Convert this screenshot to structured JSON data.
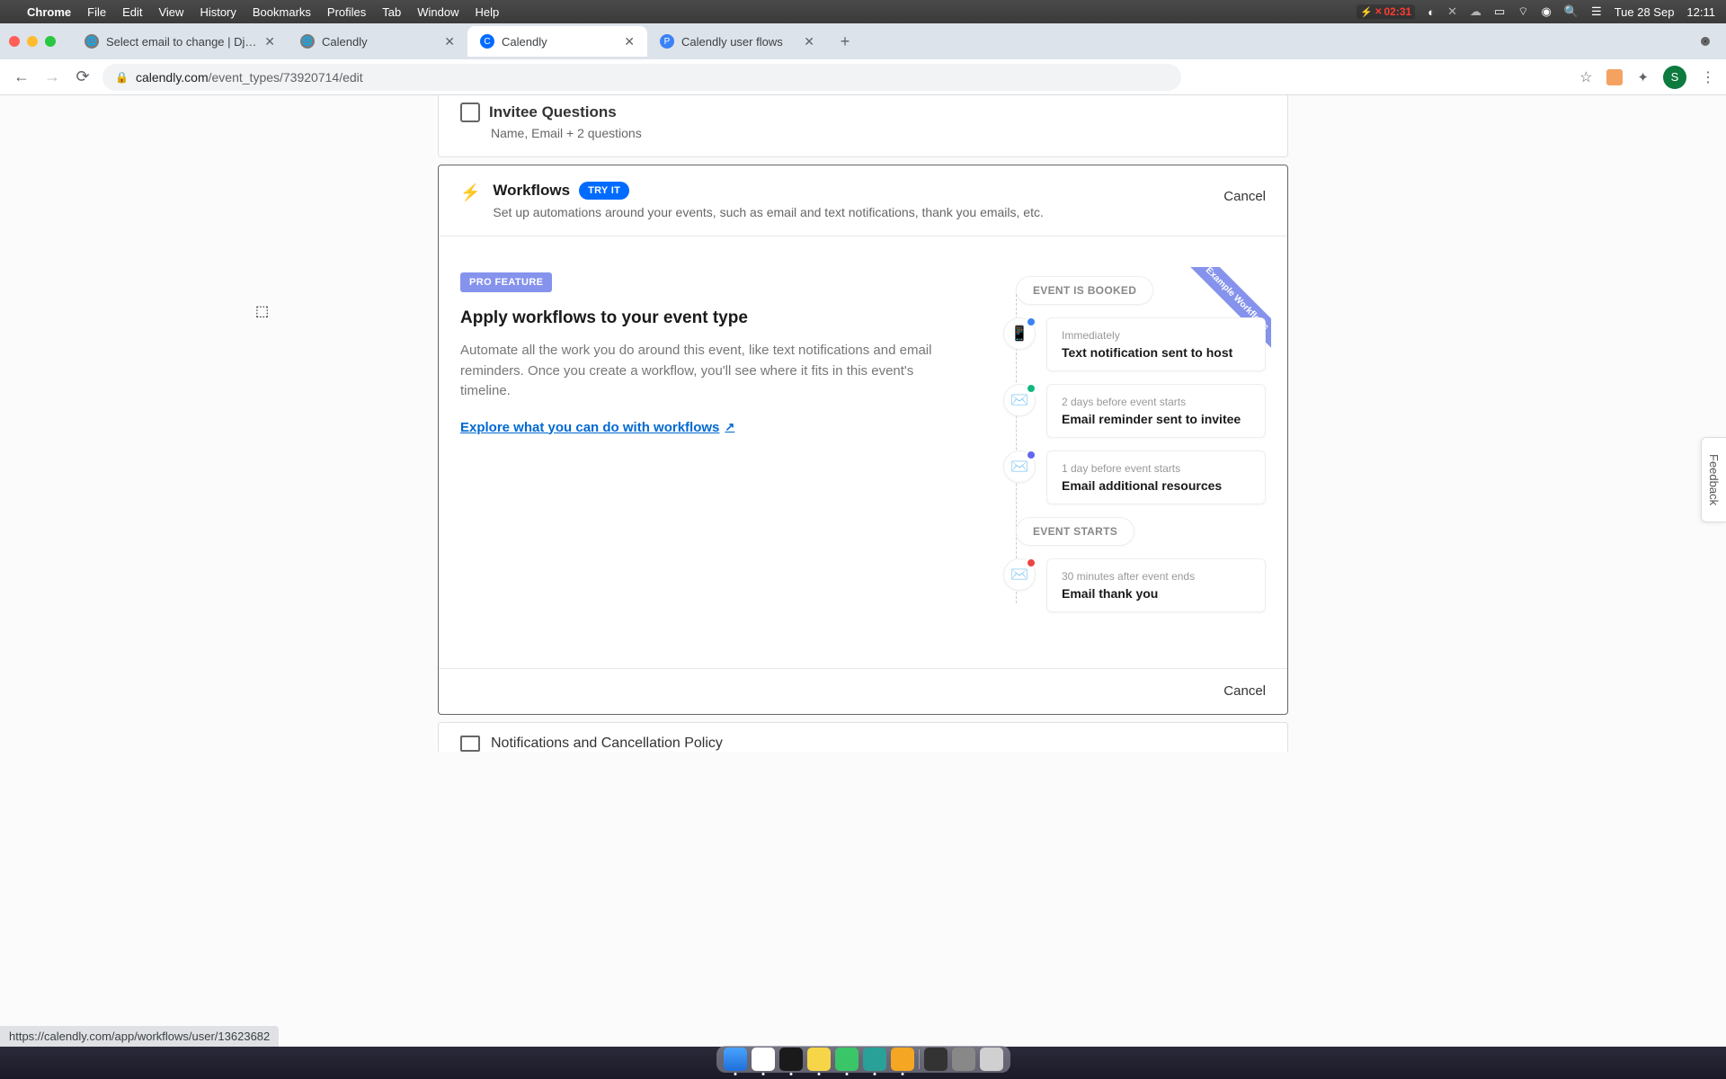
{
  "menubar": {
    "app": "Chrome",
    "menus": [
      "File",
      "Edit",
      "View",
      "History",
      "Bookmarks",
      "Profiles",
      "Tab",
      "Window",
      "Help"
    ],
    "battery_time": "02:31",
    "date": "Tue 28 Sep",
    "time": "12:11"
  },
  "tabs": [
    {
      "title": "Select email to change | Django",
      "favicon": "globe"
    },
    {
      "title": "Calendly",
      "favicon": "globe"
    },
    {
      "title": "Calendly",
      "favicon": "calendly",
      "active": true
    },
    {
      "title": "Calendly user flows",
      "favicon": "pf"
    }
  ],
  "omnibox": {
    "domain": "calendly.com",
    "path": "/event_types/73920714/edit"
  },
  "avatar_initial": "S",
  "sections": {
    "invitee": {
      "title": "Invitee Questions",
      "subtitle": "Name, Email + 2 questions"
    },
    "workflows": {
      "title": "Workflows",
      "try_label": "TRY IT",
      "subtitle": "Set up automations around your events, such as email and text notifications, thank you emails, etc.",
      "cancel": "Cancel",
      "pro_badge": "PRO FEATURE",
      "heading": "Apply workflows to your event type",
      "body": "Automate all the work you do around this event, like text notifications and email reminders. Once you create a workflow, you'll see where it fits in this event's timeline.",
      "link": "Explore what you can do with workflows",
      "ribbon": "Example Workflows",
      "timeline": {
        "pill1": "EVENT IS BOOKED",
        "pill2": "EVENT STARTS",
        "items": [
          {
            "when": "Immediately",
            "what": "Text notification sent to host",
            "icon": "phone",
            "badge": "blue"
          },
          {
            "when": "2 days before event starts",
            "what": "Email reminder sent to invitee",
            "icon": "mail",
            "badge": "green"
          },
          {
            "when": "1 day before event starts",
            "what": "Email additional resources",
            "icon": "mail",
            "badge": "indigo"
          },
          {
            "when": "30 minutes after event ends",
            "what": "Email thank you",
            "icon": "mail",
            "badge": "red"
          }
        ]
      }
    },
    "notifications": {
      "title": "Notifications and Cancellation Policy"
    }
  },
  "status_url": "https://calendly.com/app/workflows/user/13623682",
  "feedback": "Feedback"
}
